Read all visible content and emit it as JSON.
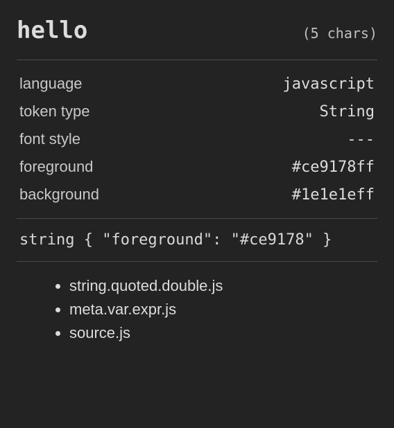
{
  "header": {
    "token": "hello",
    "char_count": "(5 chars)"
  },
  "properties": {
    "language": {
      "label": "language",
      "value": "javascript"
    },
    "token_type": {
      "label": "token type",
      "value": "String"
    },
    "font_style": {
      "label": "font style",
      "value": "---"
    },
    "foreground": {
      "label": "foreground",
      "value": "#ce9178ff"
    },
    "background": {
      "label": "background",
      "value": "#1e1e1eff"
    }
  },
  "rule": "string { \"foreground\": \"#ce9178\" }",
  "scopes": [
    "string.quoted.double.js",
    "meta.var.expr.js",
    "source.js"
  ]
}
